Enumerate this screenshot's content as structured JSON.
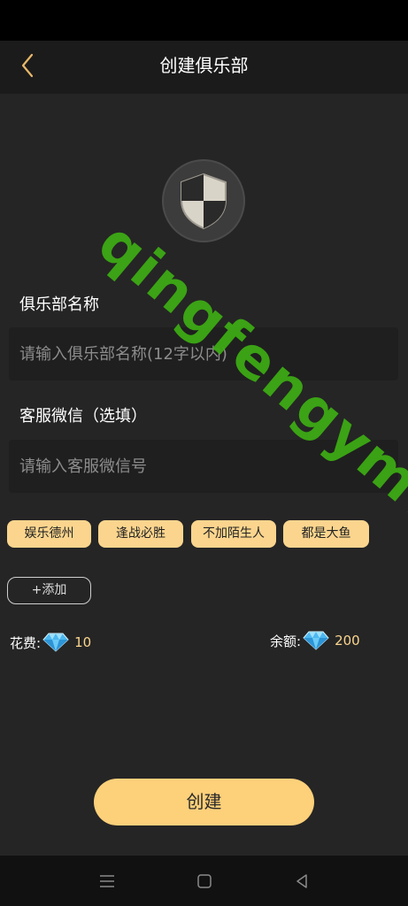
{
  "header": {
    "title": "创建俱乐部"
  },
  "form": {
    "club_name_label": "俱乐部名称",
    "club_name_placeholder": "请输入俱乐部名称(12字以内)",
    "wechat_label": "客服微信（选填）",
    "wechat_placeholder": "请输入客服微信号"
  },
  "tags": [
    "娱乐德州",
    "逢战必胜",
    "不加陌生人",
    "都是大鱼"
  ],
  "add_label": "+添加",
  "cost": {
    "label": "花费:",
    "value": "10"
  },
  "balance": {
    "label": "余额:",
    "value": "200"
  },
  "create_label": "创建",
  "watermark": "qingfengymw.com",
  "colors": {
    "accent": "#fbd58e",
    "background": "#252525",
    "header": "#1b1b1b"
  }
}
